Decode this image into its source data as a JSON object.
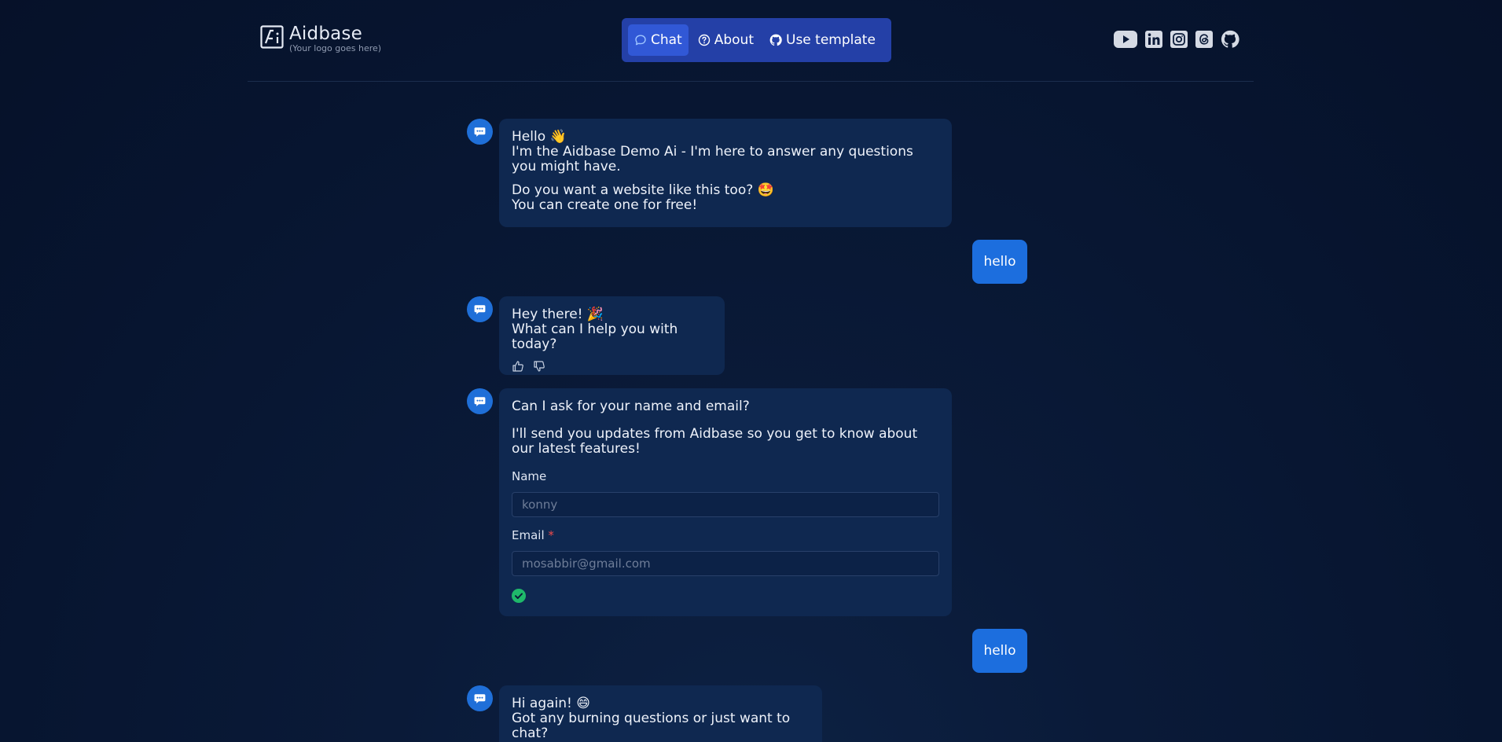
{
  "brand": {
    "name": "Aidbase",
    "tagline": "(Your logo goes here)"
  },
  "nav": [
    {
      "label": "Chat",
      "icon": "chat-bubble-icon",
      "active": true
    },
    {
      "label": "About",
      "icon": "question-circle-icon",
      "active": false
    },
    {
      "label": "Use template",
      "icon": "github-icon",
      "active": false
    }
  ],
  "social": [
    "youtube-icon",
    "linkedin-icon",
    "instagram-icon",
    "threads-icon",
    "github-icon"
  ],
  "messages": {
    "m1": {
      "line1": "Hello 👋",
      "line2": "I'm the Aidbase Demo Ai - I'm here to answer any questions you might have.",
      "line3": "Do you want a website like this too? 🤩",
      "line4": "You can create one for free!"
    },
    "u1": "hello",
    "m2": {
      "line1": "Hey there! 🎉",
      "line2": "What can I help you with today?"
    },
    "m3": {
      "line1": "Can I ask for your name and email?",
      "line2": "I'll send you updates from Aidbase so you get to know about our latest features!",
      "name_label": "Name",
      "name_value": "konny",
      "email_label": "Email",
      "email_required": "*",
      "email_value": "mosabbir@gmail.com"
    },
    "u2": "hello",
    "m4": {
      "line1": "Hi again! 😄",
      "line2": "Got any burning questions or just want to chat?"
    }
  },
  "colors": {
    "background": "#071530",
    "nav_bg": "#2440a7",
    "nav_active": "#3158d6",
    "bot_bubble": "#0f2850",
    "user_bubble": "#1c6ede",
    "avatar": "#1f6fd8",
    "success": "#1fb86a"
  }
}
